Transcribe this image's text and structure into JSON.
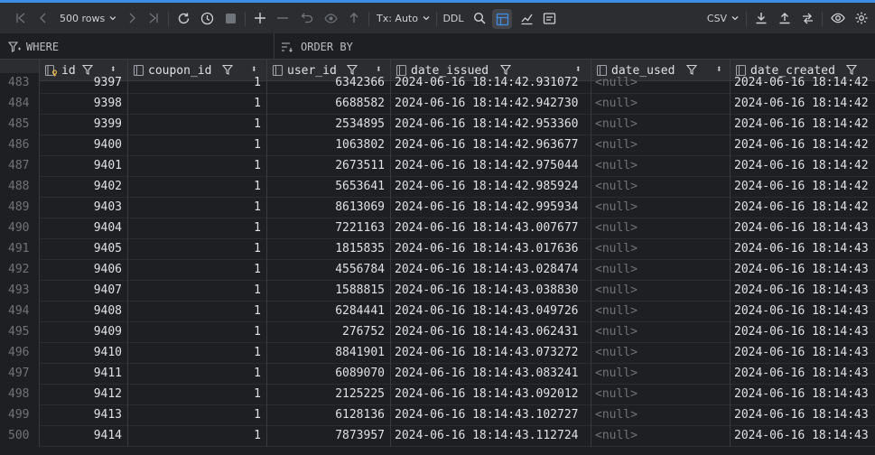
{
  "toolbar": {
    "rows_label": "500 rows",
    "tx_label": "Tx: Auto",
    "ddl_label": "DDL",
    "export_format": "CSV"
  },
  "filter": {
    "where_label": "WHERE",
    "order_label": "ORDER BY"
  },
  "columns": [
    "id",
    "coupon_id",
    "user_id",
    "date_issued",
    "date_used",
    "date_created"
  ],
  "rows": [
    {
      "n": "483",
      "id": "9397",
      "coupon_id": "1",
      "user_id": "6342366",
      "date_issued": "2024-06-16 18:14:42.931072",
      "date_used": "<null>",
      "date_created": "2024-06-16 18:14:42"
    },
    {
      "n": "484",
      "id": "9398",
      "coupon_id": "1",
      "user_id": "6688582",
      "date_issued": "2024-06-16 18:14:42.942730",
      "date_used": "<null>",
      "date_created": "2024-06-16 18:14:42"
    },
    {
      "n": "485",
      "id": "9399",
      "coupon_id": "1",
      "user_id": "2534895",
      "date_issued": "2024-06-16 18:14:42.953360",
      "date_used": "<null>",
      "date_created": "2024-06-16 18:14:42"
    },
    {
      "n": "486",
      "id": "9400",
      "coupon_id": "1",
      "user_id": "1063802",
      "date_issued": "2024-06-16 18:14:42.963677",
      "date_used": "<null>",
      "date_created": "2024-06-16 18:14:42"
    },
    {
      "n": "487",
      "id": "9401",
      "coupon_id": "1",
      "user_id": "2673511",
      "date_issued": "2024-06-16 18:14:42.975044",
      "date_used": "<null>",
      "date_created": "2024-06-16 18:14:42"
    },
    {
      "n": "488",
      "id": "9402",
      "coupon_id": "1",
      "user_id": "5653641",
      "date_issued": "2024-06-16 18:14:42.985924",
      "date_used": "<null>",
      "date_created": "2024-06-16 18:14:42"
    },
    {
      "n": "489",
      "id": "9403",
      "coupon_id": "1",
      "user_id": "8613069",
      "date_issued": "2024-06-16 18:14:42.995934",
      "date_used": "<null>",
      "date_created": "2024-06-16 18:14:42"
    },
    {
      "n": "490",
      "id": "9404",
      "coupon_id": "1",
      "user_id": "7221163",
      "date_issued": "2024-06-16 18:14:43.007677",
      "date_used": "<null>",
      "date_created": "2024-06-16 18:14:43"
    },
    {
      "n": "491",
      "id": "9405",
      "coupon_id": "1",
      "user_id": "1815835",
      "date_issued": "2024-06-16 18:14:43.017636",
      "date_used": "<null>",
      "date_created": "2024-06-16 18:14:43"
    },
    {
      "n": "492",
      "id": "9406",
      "coupon_id": "1",
      "user_id": "4556784",
      "date_issued": "2024-06-16 18:14:43.028474",
      "date_used": "<null>",
      "date_created": "2024-06-16 18:14:43"
    },
    {
      "n": "493",
      "id": "9407",
      "coupon_id": "1",
      "user_id": "1588815",
      "date_issued": "2024-06-16 18:14:43.038830",
      "date_used": "<null>",
      "date_created": "2024-06-16 18:14:43"
    },
    {
      "n": "494",
      "id": "9408",
      "coupon_id": "1",
      "user_id": "6284441",
      "date_issued": "2024-06-16 18:14:43.049726",
      "date_used": "<null>",
      "date_created": "2024-06-16 18:14:43"
    },
    {
      "n": "495",
      "id": "9409",
      "coupon_id": "1",
      "user_id": "276752",
      "date_issued": "2024-06-16 18:14:43.062431",
      "date_used": "<null>",
      "date_created": "2024-06-16 18:14:43"
    },
    {
      "n": "496",
      "id": "9410",
      "coupon_id": "1",
      "user_id": "8841901",
      "date_issued": "2024-06-16 18:14:43.073272",
      "date_used": "<null>",
      "date_created": "2024-06-16 18:14:43"
    },
    {
      "n": "497",
      "id": "9411",
      "coupon_id": "1",
      "user_id": "6089070",
      "date_issued": "2024-06-16 18:14:43.083241",
      "date_used": "<null>",
      "date_created": "2024-06-16 18:14:43"
    },
    {
      "n": "498",
      "id": "9412",
      "coupon_id": "1",
      "user_id": "2125225",
      "date_issued": "2024-06-16 18:14:43.092012",
      "date_used": "<null>",
      "date_created": "2024-06-16 18:14:43"
    },
    {
      "n": "499",
      "id": "9413",
      "coupon_id": "1",
      "user_id": "6128136",
      "date_issued": "2024-06-16 18:14:43.102727",
      "date_used": "<null>",
      "date_created": "2024-06-16 18:14:43"
    },
    {
      "n": "500",
      "id": "9414",
      "coupon_id": "1",
      "user_id": "7873957",
      "date_issued": "2024-06-16 18:14:43.112724",
      "date_used": "<null>",
      "date_created": "2024-06-16 18:14:43"
    }
  ]
}
